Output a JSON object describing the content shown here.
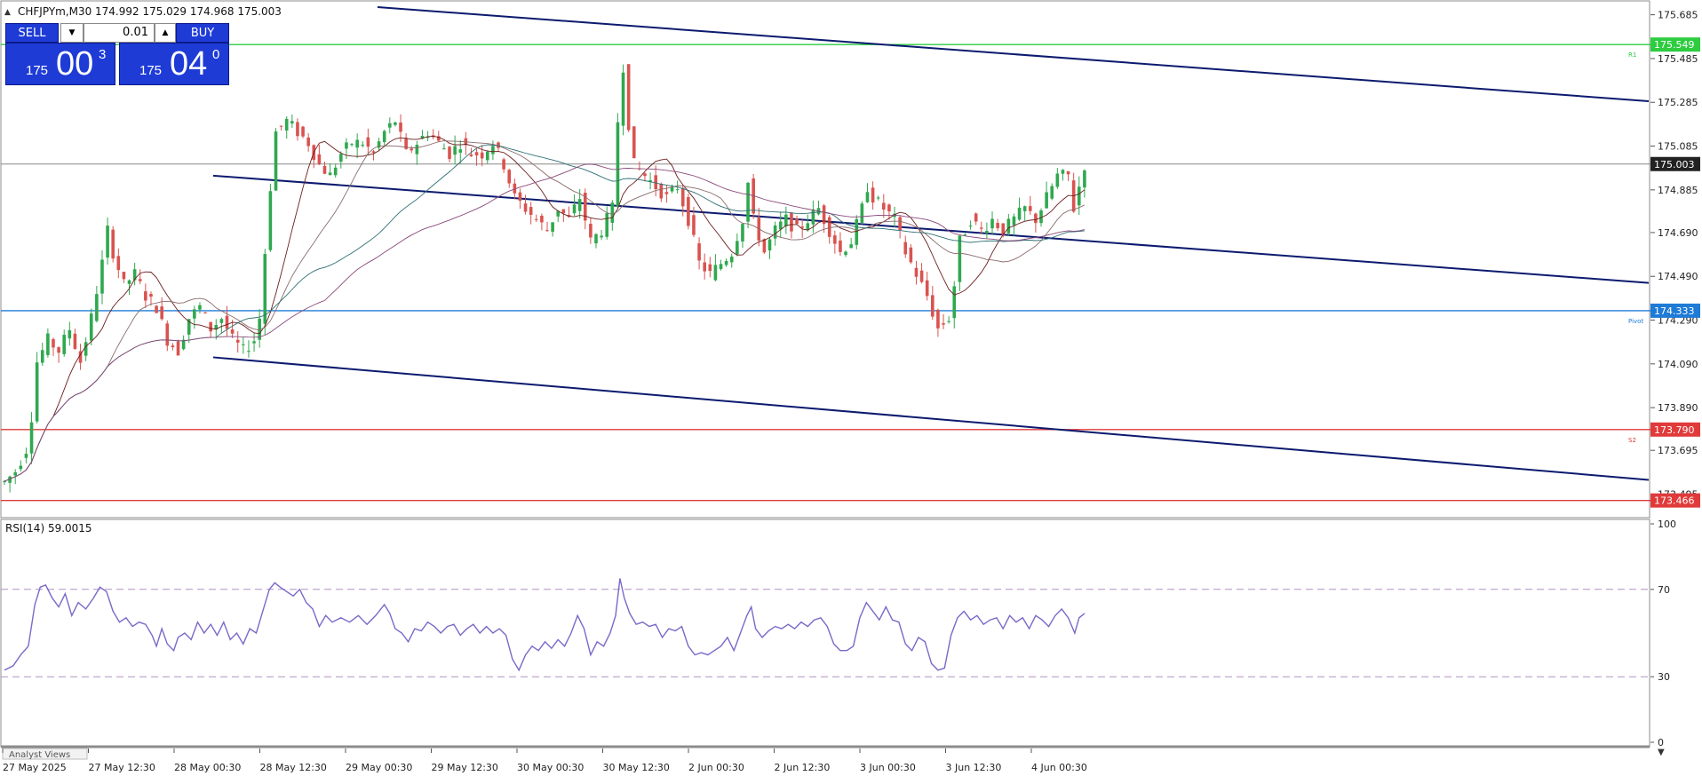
{
  "header": {
    "symbol_line": "CHFJPYm,M30",
    "ohlc": "174.992 175.029 174.968 175.003"
  },
  "trade_panel": {
    "sell_label": "SELL",
    "buy_label": "BUY",
    "lot": "0.01",
    "sell_price": {
      "big_prefix": "175",
      "big": "00",
      "sup": "3"
    },
    "buy_price": {
      "big_prefix": "175",
      "big": "04",
      "sup": "0"
    }
  },
  "colors": {
    "bull": "#2fa84f",
    "bear": "#d9534f",
    "channel": "#0b1a6e",
    "r1": "#2ecc40",
    "pivot": "#1e7bd6",
    "support": "#e03a3a",
    "rsi": "#7b68c8",
    "current_price": "#888888"
  },
  "chart_data": {
    "type": "line",
    "price_axis": {
      "ticks": [
        "175.685",
        "175.485",
        "175.285",
        "175.085",
        "174.885",
        "174.690",
        "174.490",
        "174.290",
        "174.090",
        "173.890",
        "173.695",
        "173.495"
      ],
      "range": [
        173.42,
        175.72
      ]
    },
    "time_axis": {
      "labels": [
        "27 May 2025",
        "27 May 12:30",
        "28 May 00:30",
        "28 May 12:30",
        "29 May 00:30",
        "29 May 12:30",
        "30 May 00:30",
        "30 May 12:30",
        "2 Jun 00:30",
        "2 Jun 12:30",
        "3 Jun 00:30",
        "3 Jun 12:30",
        "4 Jun 00:30"
      ]
    },
    "levels": [
      {
        "name": "R1",
        "value": 175.549,
        "label": "175.549",
        "tag": "R1"
      },
      {
        "name": "Pivot",
        "value": 174.333,
        "label": "174.333",
        "tag": "Pivot"
      },
      {
        "name": "S2",
        "value": 173.79,
        "label": "173.790",
        "tag": "S2"
      },
      {
        "name": "S3",
        "value": 173.466,
        "label": "173.466",
        "tag": ""
      }
    ],
    "current_price": {
      "value": 175.003,
      "label": "175.003"
    },
    "price_series_approx": [
      [
        0,
        173.55
      ],
      [
        10,
        173.6
      ],
      [
        20,
        173.7
      ],
      [
        25,
        173.85
      ],
      [
        30,
        174.1
      ],
      [
        40,
        174.2
      ],
      [
        50,
        174.15
      ],
      [
        60,
        174.25
      ],
      [
        70,
        174.1
      ],
      [
        80,
        174.3
      ],
      [
        90,
        174.55
      ],
      [
        95,
        174.7
      ],
      [
        100,
        174.6
      ],
      [
        110,
        174.45
      ],
      [
        120,
        174.5
      ],
      [
        130,
        174.4
      ],
      [
        140,
        174.35
      ],
      [
        150,
        174.2
      ],
      [
        160,
        174.15
      ],
      [
        170,
        174.3
      ],
      [
        180,
        174.35
      ],
      [
        190,
        174.25
      ],
      [
        200,
        174.3
      ],
      [
        210,
        174.2
      ],
      [
        220,
        174.15
      ],
      [
        230,
        174.2
      ],
      [
        235,
        174.3
      ],
      [
        240,
        174.6
      ],
      [
        245,
        174.9
      ],
      [
        250,
        175.15
      ],
      [
        260,
        175.2
      ],
      [
        270,
        175.15
      ],
      [
        280,
        175.1
      ],
      [
        290,
        175.0
      ],
      [
        300,
        174.95
      ],
      [
        310,
        175.05
      ],
      [
        320,
        175.1
      ],
      [
        330,
        175.1
      ],
      [
        340,
        175.05
      ],
      [
        350,
        175.15
      ],
      [
        360,
        175.2
      ],
      [
        370,
        175.05
      ],
      [
        380,
        175.1
      ],
      [
        390,
        175.15
      ],
      [
        400,
        175.1
      ],
      [
        410,
        175.05
      ],
      [
        420,
        175.1
      ],
      [
        430,
        175.05
      ],
      [
        440,
        175.05
      ],
      [
        450,
        175.1
      ],
      [
        460,
        175.0
      ],
      [
        470,
        174.85
      ],
      [
        480,
        174.8
      ],
      [
        490,
        174.75
      ],
      [
        500,
        174.7
      ],
      [
        510,
        174.8
      ],
      [
        520,
        174.75
      ],
      [
        530,
        174.85
      ],
      [
        540,
        174.65
      ],
      [
        550,
        174.7
      ],
      [
        560,
        174.8
      ],
      [
        565,
        175.2
      ],
      [
        568,
        175.6
      ],
      [
        572,
        175.3
      ],
      [
        580,
        175.0
      ],
      [
        590,
        174.95
      ],
      [
        600,
        174.9
      ],
      [
        610,
        174.85
      ],
      [
        620,
        174.9
      ],
      [
        630,
        174.75
      ],
      [
        640,
        174.55
      ],
      [
        650,
        174.5
      ],
      [
        660,
        174.55
      ],
      [
        670,
        174.6
      ],
      [
        680,
        174.75
      ],
      [
        686,
        174.95
      ],
      [
        690,
        174.75
      ],
      [
        700,
        174.6
      ],
      [
        710,
        174.7
      ],
      [
        720,
        174.75
      ],
      [
        730,
        174.7
      ],
      [
        740,
        174.75
      ],
      [
        750,
        174.8
      ],
      [
        760,
        174.7
      ],
      [
        770,
        174.6
      ],
      [
        780,
        174.65
      ],
      [
        790,
        174.8
      ],
      [
        795,
        174.9
      ],
      [
        800,
        174.85
      ],
      [
        810,
        174.8
      ],
      [
        820,
        174.75
      ],
      [
        830,
        174.6
      ],
      [
        840,
        174.5
      ],
      [
        850,
        174.4
      ],
      [
        860,
        174.25
      ],
      [
        870,
        174.3
      ],
      [
        875,
        174.45
      ],
      [
        880,
        174.65
      ],
      [
        890,
        174.75
      ],
      [
        900,
        174.7
      ],
      [
        910,
        174.75
      ],
      [
        920,
        174.7
      ],
      [
        930,
        174.75
      ],
      [
        940,
        174.8
      ],
      [
        950,
        174.75
      ],
      [
        960,
        174.85
      ],
      [
        970,
        174.95
      ],
      [
        980,
        174.95
      ],
      [
        985,
        174.8
      ],
      [
        990,
        174.9
      ],
      [
        995,
        175.0
      ]
    ],
    "rsi": {
      "label": "RSI(14) 59.0015",
      "value": 59.0015,
      "levels": [
        70,
        30
      ],
      "axis_ticks": [
        "100",
        "70",
        "30",
        "0"
      ],
      "range": [
        0,
        100
      ],
      "series_approx": [
        [
          0,
          33
        ],
        [
          8,
          35
        ],
        [
          15,
          40
        ],
        [
          22,
          44
        ],
        [
          28,
          63
        ],
        [
          33,
          71
        ],
        [
          38,
          72
        ],
        [
          44,
          66
        ],
        [
          50,
          62
        ],
        [
          56,
          68
        ],
        [
          62,
          58
        ],
        [
          68,
          64
        ],
        [
          75,
          61
        ],
        [
          82,
          66
        ],
        [
          88,
          71
        ],
        [
          94,
          69
        ],
        [
          100,
          60
        ],
        [
          106,
          55
        ],
        [
          112,
          57
        ],
        [
          118,
          53
        ],
        [
          124,
          55
        ],
        [
          130,
          54
        ],
        [
          136,
          49
        ],
        [
          140,
          44
        ],
        [
          145,
          52
        ],
        [
          150,
          45
        ],
        [
          156,
          42
        ],
        [
          160,
          48
        ],
        [
          166,
          50
        ],
        [
          172,
          47
        ],
        [
          178,
          55
        ],
        [
          184,
          50
        ],
        [
          190,
          54
        ],
        [
          196,
          49
        ],
        [
          202,
          55
        ],
        [
          208,
          47
        ],
        [
          214,
          50
        ],
        [
          220,
          45
        ],
        [
          226,
          52
        ],
        [
          232,
          50
        ],
        [
          238,
          60
        ],
        [
          244,
          70
        ],
        [
          249,
          73
        ],
        [
          254,
          71
        ],
        [
          260,
          69
        ],
        [
          266,
          67
        ],
        [
          272,
          70
        ],
        [
          278,
          64
        ],
        [
          284,
          61
        ],
        [
          290,
          53
        ],
        [
          296,
          58
        ],
        [
          302,
          55
        ],
        [
          310,
          57
        ],
        [
          318,
          55
        ],
        [
          326,
          58
        ],
        [
          334,
          54
        ],
        [
          342,
          58
        ],
        [
          350,
          63
        ],
        [
          355,
          59
        ],
        [
          360,
          52
        ],
        [
          366,
          50
        ],
        [
          372,
          46
        ],
        [
          378,
          52
        ],
        [
          384,
          51
        ],
        [
          390,
          55
        ],
        [
          396,
          53
        ],
        [
          402,
          50
        ],
        [
          408,
          53
        ],
        [
          414,
          54
        ],
        [
          420,
          49
        ],
        [
          426,
          52
        ],
        [
          432,
          54
        ],
        [
          438,
          50
        ],
        [
          444,
          53
        ],
        [
          450,
          50
        ],
        [
          456,
          52
        ],
        [
          462,
          49
        ],
        [
          468,
          38
        ],
        [
          474,
          33
        ],
        [
          480,
          40
        ],
        [
          486,
          44
        ],
        [
          492,
          42
        ],
        [
          498,
          46
        ],
        [
          504,
          43
        ],
        [
          510,
          47
        ],
        [
          516,
          44
        ],
        [
          522,
          50
        ],
        [
          528,
          58
        ],
        [
          534,
          52
        ],
        [
          540,
          40
        ],
        [
          546,
          46
        ],
        [
          552,
          44
        ],
        [
          558,
          50
        ],
        [
          563,
          58
        ],
        [
          567,
          75
        ],
        [
          571,
          66
        ],
        [
          576,
          59
        ],
        [
          582,
          54
        ],
        [
          588,
          55
        ],
        [
          594,
          53
        ],
        [
          600,
          54
        ],
        [
          606,
          48
        ],
        [
          612,
          52
        ],
        [
          618,
          51
        ],
        [
          624,
          53
        ],
        [
          630,
          44
        ],
        [
          636,
          40
        ],
        [
          642,
          41
        ],
        [
          648,
          40
        ],
        [
          654,
          42
        ],
        [
          660,
          44
        ],
        [
          666,
          48
        ],
        [
          672,
          42
        ],
        [
          678,
          50
        ],
        [
          684,
          58
        ],
        [
          688,
          62
        ],
        [
          692,
          52
        ],
        [
          698,
          48
        ],
        [
          704,
          51
        ],
        [
          710,
          53
        ],
        [
          716,
          52
        ],
        [
          722,
          54
        ],
        [
          728,
          52
        ],
        [
          734,
          55
        ],
        [
          740,
          53
        ],
        [
          746,
          56
        ],
        [
          752,
          57
        ],
        [
          758,
          53
        ],
        [
          764,
          45
        ],
        [
          770,
          42
        ],
        [
          776,
          42
        ],
        [
          782,
          44
        ],
        [
          788,
          57
        ],
        [
          794,
          64
        ],
        [
          800,
          60
        ],
        [
          806,
          56
        ],
        [
          812,
          62
        ],
        [
          818,
          56
        ],
        [
          824,
          55
        ],
        [
          830,
          45
        ],
        [
          836,
          42
        ],
        [
          842,
          48
        ],
        [
          848,
          46
        ],
        [
          854,
          36
        ],
        [
          860,
          33
        ],
        [
          866,
          34
        ],
        [
          872,
          49
        ],
        [
          878,
          57
        ],
        [
          884,
          60
        ],
        [
          890,
          56
        ],
        [
          896,
          58
        ],
        [
          902,
          54
        ],
        [
          908,
          56
        ],
        [
          914,
          57
        ],
        [
          920,
          52
        ],
        [
          926,
          58
        ],
        [
          932,
          55
        ],
        [
          938,
          57
        ],
        [
          944,
          52
        ],
        [
          950,
          58
        ],
        [
          956,
          56
        ],
        [
          962,
          53
        ],
        [
          968,
          58
        ],
        [
          974,
          61
        ],
        [
          980,
          57
        ],
        [
          986,
          50
        ],
        [
          990,
          57
        ],
        [
          995,
          59
        ]
      ]
    },
    "footer_tab": "Analyst Views"
  }
}
